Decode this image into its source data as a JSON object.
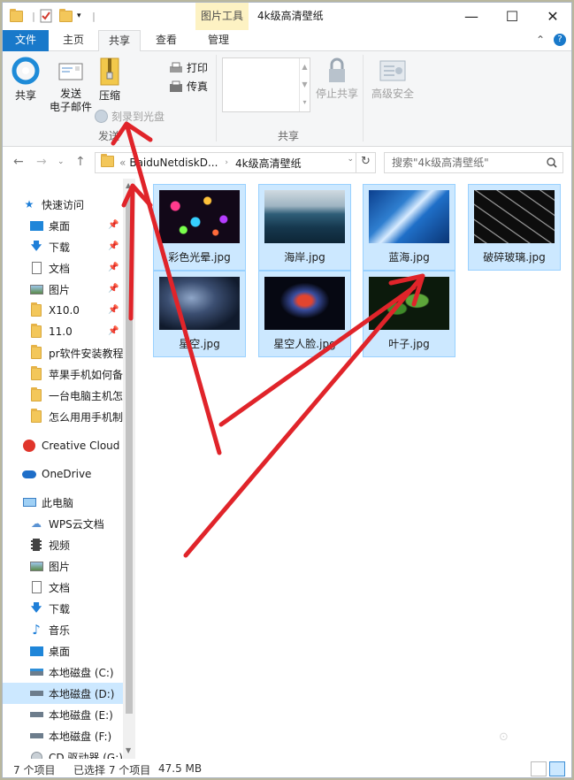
{
  "window": {
    "title": "4k级高清壁纸",
    "context_tab": "图片工具",
    "minimize": "—",
    "maximize": "☐",
    "close": "✕"
  },
  "tabs": {
    "file": "文件",
    "home": "主页",
    "share": "共享",
    "view": "查看",
    "manage": "管理"
  },
  "ribbon": {
    "share_label": "共享",
    "email_label": "发送\n电子邮件",
    "email_line1": "发送",
    "email_line2": "电子邮件",
    "zip_label": "压缩",
    "burn_label": "刻录到光盘",
    "print_label": "打印",
    "fax_label": "传真",
    "send_group": "发送",
    "stop_share_label": "停止共享",
    "share_group": "共享",
    "advanced_security_label": "高级安全"
  },
  "address": {
    "overflow": "«",
    "crumb_parent": "BaiduNetdiskD...",
    "crumb_current": "4k级高清壁纸",
    "search_placeholder": "搜索\"4k级高清壁纸\""
  },
  "sidebar": {
    "quick_access": "快速访问",
    "items": [
      {
        "label": "桌面",
        "icon": "desktop-icon",
        "pinned": true
      },
      {
        "label": "下载",
        "icon": "download-icon",
        "pinned": true
      },
      {
        "label": "文档",
        "icon": "document-icon",
        "pinned": true
      },
      {
        "label": "图片",
        "icon": "pictures-icon",
        "pinned": true
      },
      {
        "label": "X10.0",
        "icon": "folder-icon",
        "pinned": true
      },
      {
        "label": "11.0",
        "icon": "folder-icon",
        "pinned": true
      },
      {
        "label": "pr软件安装教程",
        "icon": "folder-icon",
        "pinned": false
      },
      {
        "label": "苹果手机如何备",
        "icon": "folder-icon",
        "pinned": false
      },
      {
        "label": "一台电脑主机怎",
        "icon": "folder-icon",
        "pinned": false
      },
      {
        "label": "怎么用用手机制",
        "icon": "folder-icon",
        "pinned": false
      }
    ],
    "creative_cloud": "Creative Cloud",
    "onedrive": "OneDrive",
    "this_pc": "此电脑",
    "pc_items": [
      {
        "label": "WPS云文档",
        "icon": "cloud-icon"
      },
      {
        "label": "视频",
        "icon": "video-icon"
      },
      {
        "label": "图片",
        "icon": "pictures-icon"
      },
      {
        "label": "文档",
        "icon": "document-icon"
      },
      {
        "label": "下载",
        "icon": "download-icon"
      },
      {
        "label": "音乐",
        "icon": "music-icon"
      },
      {
        "label": "桌面",
        "icon": "desktop-icon"
      },
      {
        "label": "本地磁盘 (C:)",
        "icon": "drive-c-icon"
      },
      {
        "label": "本地磁盘 (D:)",
        "icon": "drive-icon"
      },
      {
        "label": "本地磁盘 (E:)",
        "icon": "drive-icon"
      },
      {
        "label": "本地磁盘 (F:)",
        "icon": "drive-icon"
      },
      {
        "label": "CD 驱动器 (G:)",
        "icon": "cd-icon"
      }
    ]
  },
  "files": [
    {
      "name": "彩色光晕.jpg",
      "thumb": "bokeh"
    },
    {
      "name": "海岸.jpg",
      "thumb": "coast"
    },
    {
      "name": "蓝海.jpg",
      "thumb": "wave"
    },
    {
      "name": "破碎玻璃.jpg",
      "thumb": "glass"
    },
    {
      "name": "星空.jpg",
      "thumb": "galaxy"
    },
    {
      "name": "星空人脸.jpg",
      "thumb": "face"
    },
    {
      "name": "叶子.jpg",
      "thumb": "leaves"
    }
  ],
  "status": {
    "count": "7 个项目",
    "selected": "已选择 7 个项目",
    "size": "47.5 MB"
  },
  "colors": {
    "accent": "#1979ca",
    "selection": "#cce8ff",
    "arrow": "#e0242a"
  }
}
